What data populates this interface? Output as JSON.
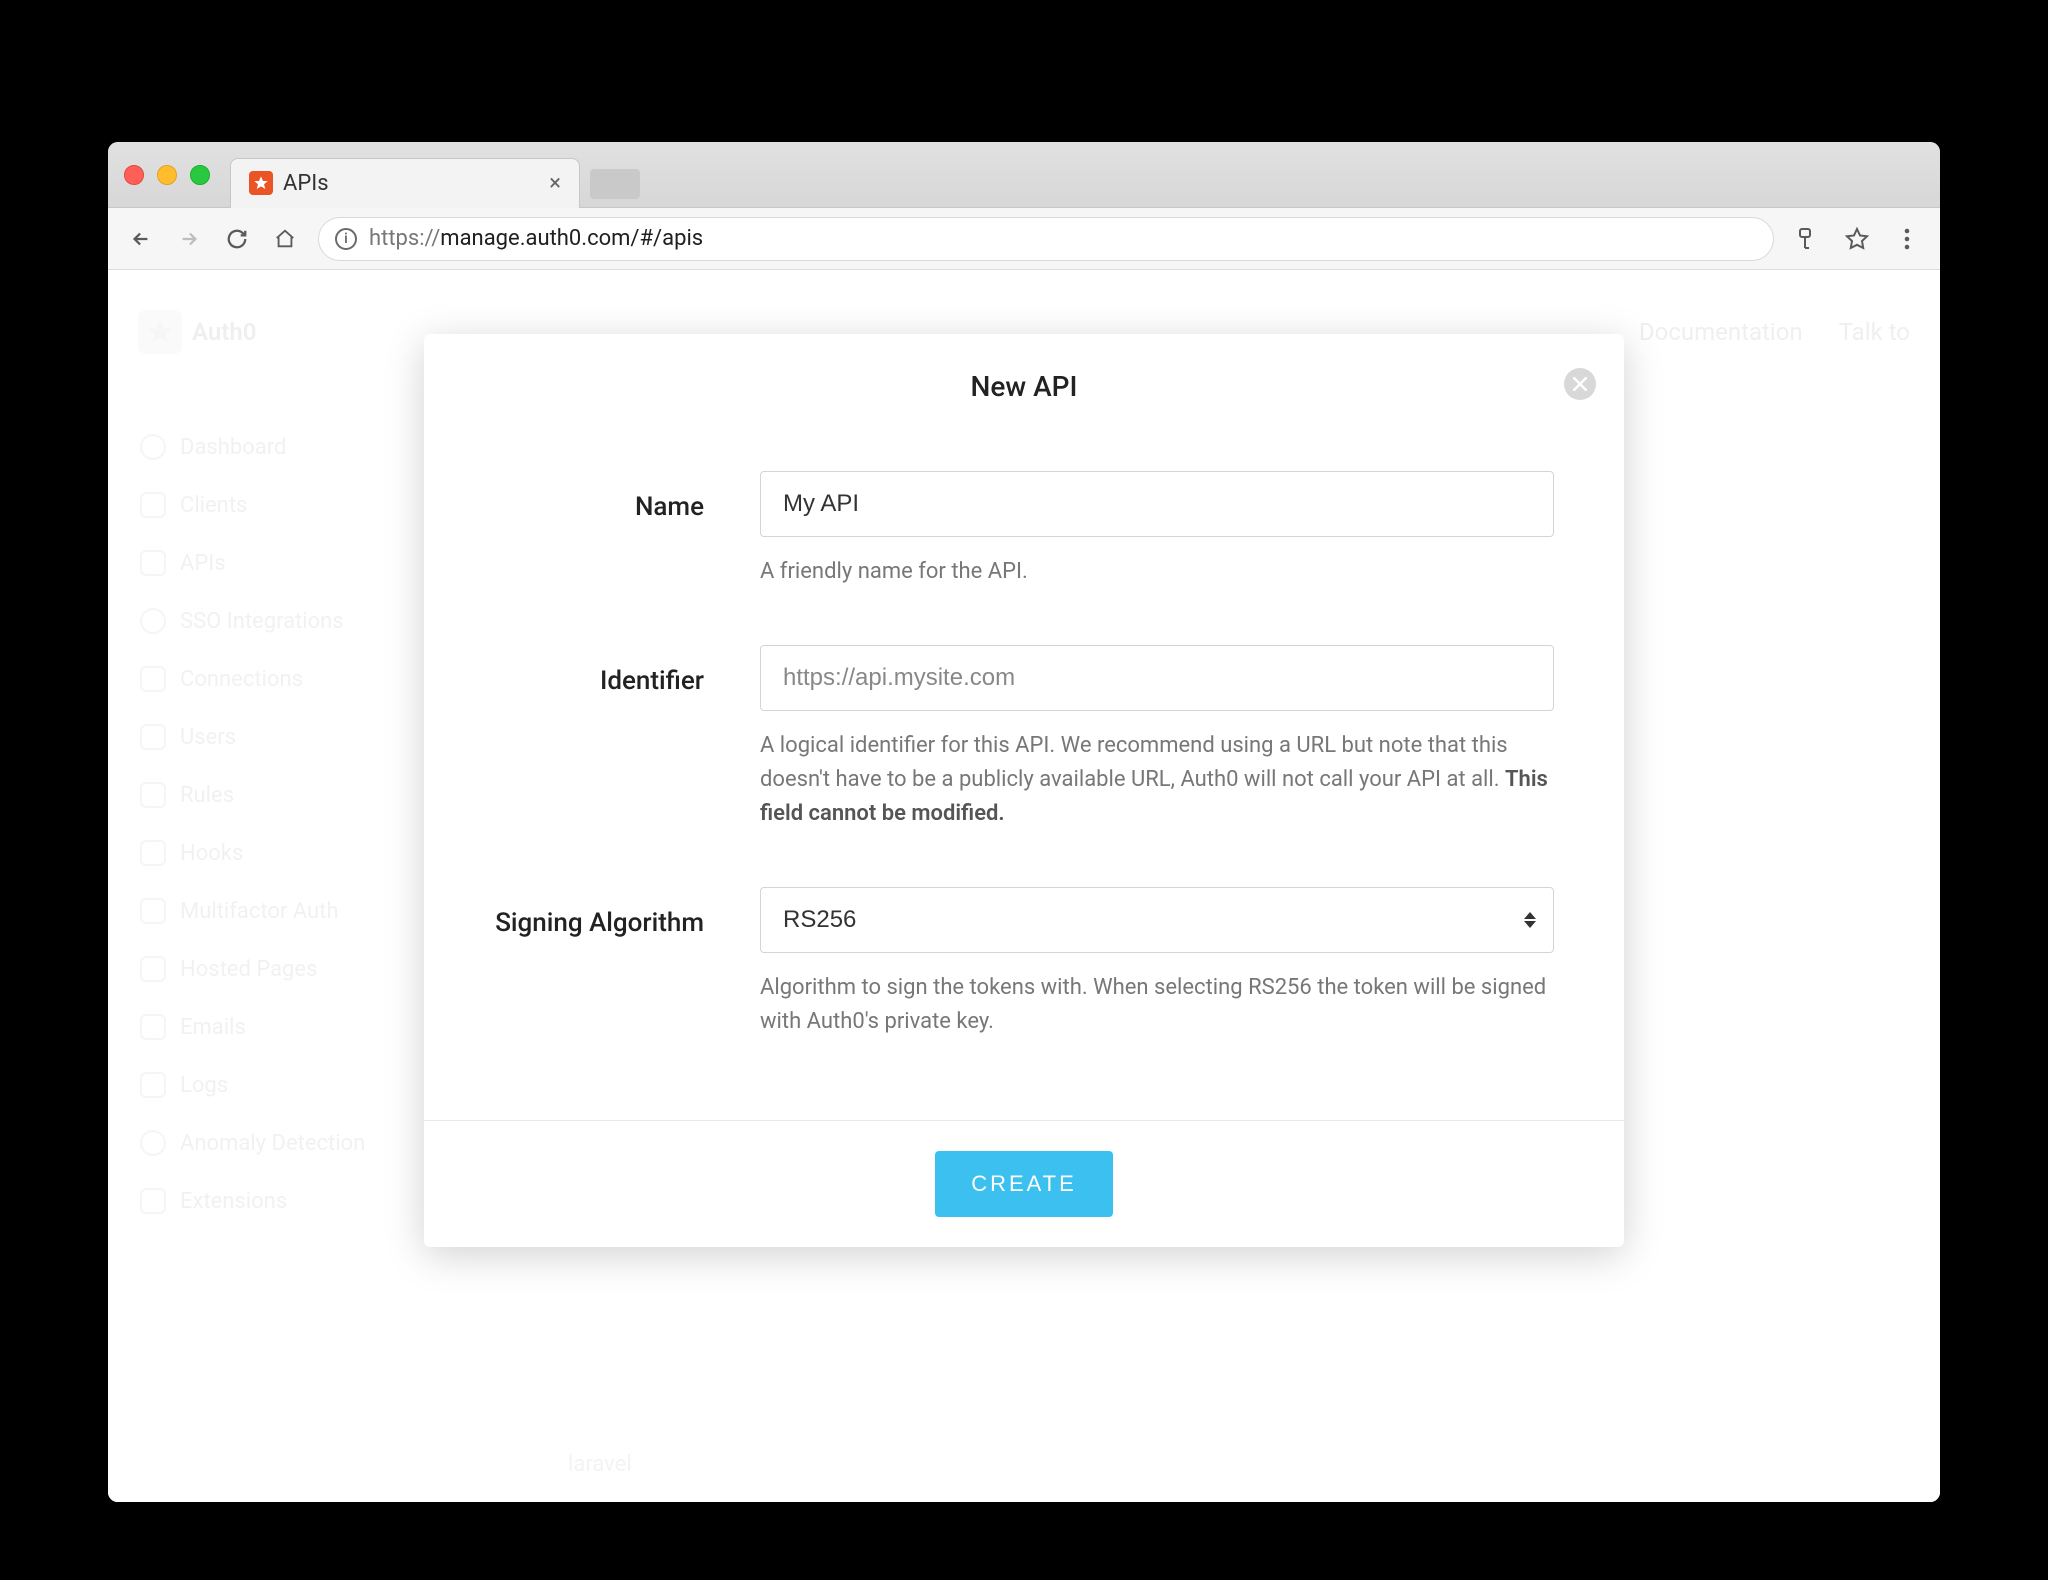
{
  "browser": {
    "tab_title": "APIs",
    "url_protocol": "https://",
    "url_rest": "manage.auth0.com/#/apis"
  },
  "header": {
    "brand": "Auth0",
    "links": {
      "docs": "Documentation",
      "talk": "Talk to"
    }
  },
  "sidebar": {
    "items": [
      {
        "label": "Dashboard"
      },
      {
        "label": "Clients"
      },
      {
        "label": "APIs"
      },
      {
        "label": "SSO Integrations"
      },
      {
        "label": "Connections"
      },
      {
        "label": "Users"
      },
      {
        "label": "Rules"
      },
      {
        "label": "Hooks"
      },
      {
        "label": "Multifactor Auth"
      },
      {
        "label": "Hosted Pages"
      },
      {
        "label": "Emails"
      },
      {
        "label": "Logs"
      },
      {
        "label": "Anomaly Detection"
      },
      {
        "label": "Extensions"
      }
    ]
  },
  "background": {
    "tag": "laravel"
  },
  "modal": {
    "title": "New API",
    "name": {
      "label": "Name",
      "value": "My API",
      "help": "A friendly name for the API."
    },
    "identifier": {
      "label": "Identifier",
      "placeholder": "https://api.mysite.com",
      "help_prefix": "A logical identifier for this API. We recommend using a URL but note that this doesn't have to be a publicly available URL, Auth0 will not call your API at all. ",
      "help_bold": "This field cannot be modified."
    },
    "algorithm": {
      "label": "Signing Algorithm",
      "value": "RS256",
      "help": "Algorithm to sign the tokens with. When selecting RS256 the token will be signed with Auth0's private key."
    },
    "create_label": "CREATE"
  }
}
